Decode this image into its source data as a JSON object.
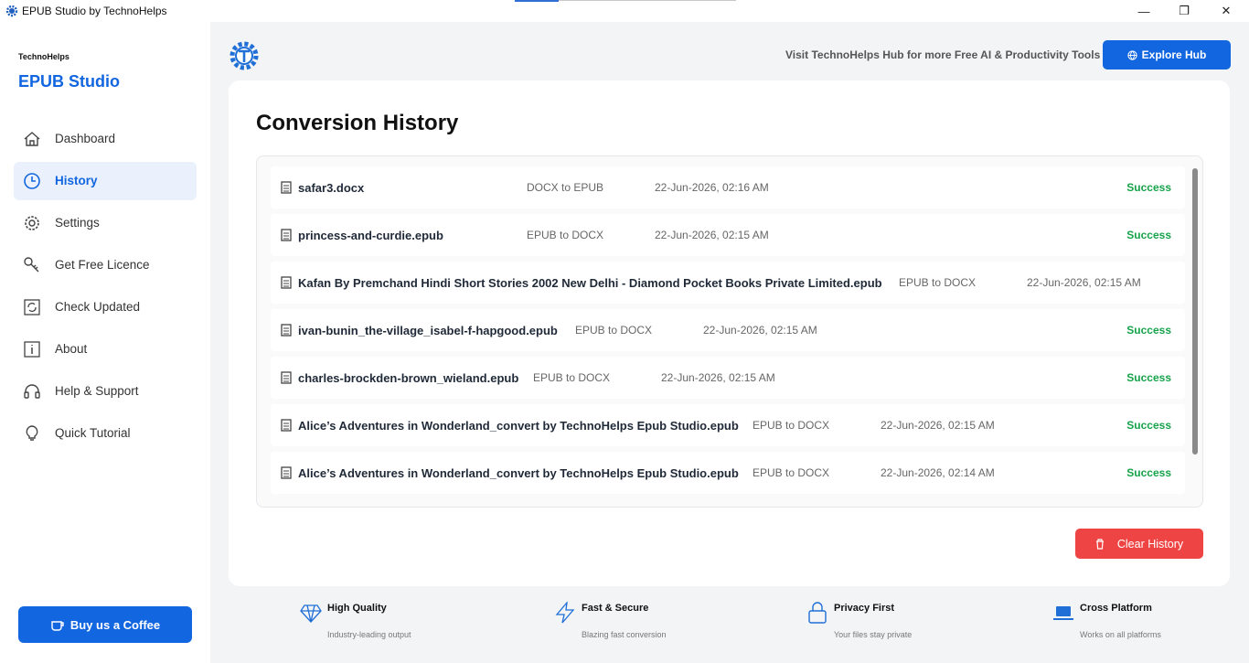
{
  "window": {
    "title": "EPUB Studio by TechnoHelps",
    "minimize": "—",
    "maximize": "❐",
    "close": "✕"
  },
  "sidebar": {
    "brand_small": "TechnoHelps",
    "brand_big": "EPUB Studio",
    "items": [
      {
        "label": "Dashboard",
        "icon": "home-icon"
      },
      {
        "label": "History",
        "icon": "clock-icon"
      },
      {
        "label": "Settings",
        "icon": "gear-icon"
      },
      {
        "label": "Get Free Licence",
        "icon": "key-icon"
      },
      {
        "label": "Check Updated",
        "icon": "refresh-icon"
      },
      {
        "label": "About",
        "icon": "info-icon"
      },
      {
        "label": "Help & Support",
        "icon": "headset-icon"
      },
      {
        "label": "Quick Tutorial",
        "icon": "lightbulb-icon"
      }
    ],
    "active": "History",
    "coffee_label": "Buy us a Coffee"
  },
  "header": {
    "visit_text": "Visit TechnoHelps Hub for more Free AI & Productivity Tools",
    "explore_label": "Explore Hub"
  },
  "history": {
    "title": "Conversion History",
    "rows": [
      {
        "name": "safar3.docx",
        "type": "DOCX to EPUB",
        "date": "22-Jun-2026, 02:16 AM",
        "status": "Success"
      },
      {
        "name": "princess-and-curdie.epub",
        "type": "EPUB to DOCX",
        "date": "22-Jun-2026, 02:15 AM",
        "status": "Success"
      },
      {
        "name": "Kafan By Premchand Hindi Short Stories 2002 New Delhi - Diamond Pocket Books Private Limited.epub",
        "type": "EPUB to DOCX",
        "date": "22-Jun-2026, 02:15 AM",
        "status": ""
      },
      {
        "name": "ivan-bunin_the-village_isabel-f-hapgood.epub",
        "type": "EPUB to DOCX",
        "date": "22-Jun-2026, 02:15 AM",
        "status": "Success"
      },
      {
        "name": "charles-brockden-brown_wieland.epub",
        "type": "EPUB to DOCX",
        "date": "22-Jun-2026, 02:15 AM",
        "status": "Success"
      },
      {
        "name": "Alice’s Adventures in Wonderland_convert by TechnoHelps Epub Studio.epub",
        "type": "EPUB to DOCX",
        "date": "22-Jun-2026, 02:15 AM",
        "status": "Success"
      },
      {
        "name": "Alice’s Adventures in Wonderland_convert by TechnoHelps Epub Studio.epub",
        "type": "EPUB to DOCX",
        "date": "22-Jun-2026, 02:14 AM",
        "status": "Success"
      }
    ],
    "clear_label": "Clear History"
  },
  "features": [
    {
      "title": "High Quality",
      "subtitle": "Industry-leading output",
      "icon": "diamond-icon"
    },
    {
      "title": "Fast & Secure",
      "subtitle": "Blazing fast conversion",
      "icon": "lightning-icon"
    },
    {
      "title": "Privacy First",
      "subtitle": "Your files stay private",
      "icon": "lock-icon"
    },
    {
      "title": "Cross Platform",
      "subtitle": "Works on all platforms",
      "icon": "laptop-icon"
    }
  ],
  "colors": {
    "accent": "#1266e0",
    "success": "#16a34a",
    "danger": "#ef4444",
    "background": "#f3f4f6"
  }
}
